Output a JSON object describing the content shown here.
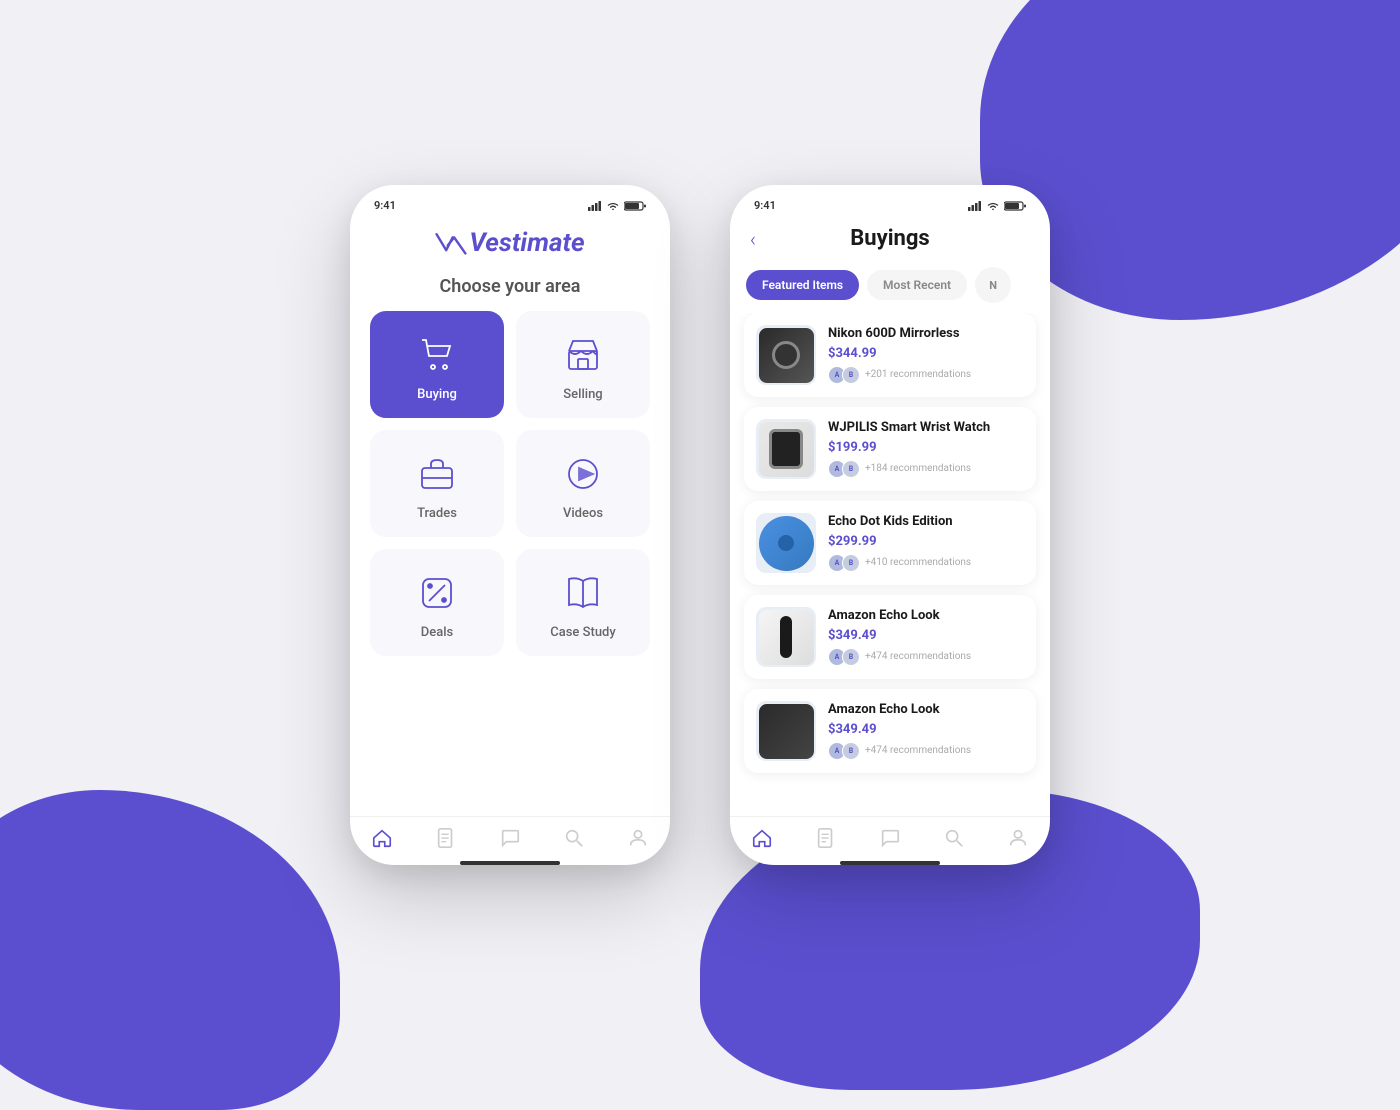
{
  "background": {
    "color": "#f0f0f5",
    "accent": "#5b4fcf"
  },
  "phone1": {
    "status_bar": {
      "time": "9:41",
      "signal": "▲▲▲",
      "wifi": "wifi",
      "battery": "battery"
    },
    "logo": "Vestimate",
    "choose_area_title": "Choose your area",
    "grid_items": [
      {
        "id": "buying",
        "label": "Buying",
        "active": true,
        "icon": "cart"
      },
      {
        "id": "selling",
        "label": "Selling",
        "active": false,
        "icon": "store"
      },
      {
        "id": "trades",
        "label": "Trades",
        "active": false,
        "icon": "briefcase"
      },
      {
        "id": "videos",
        "label": "Videos",
        "active": false,
        "icon": "play"
      },
      {
        "id": "deals",
        "label": "Deals",
        "active": false,
        "icon": "percent"
      },
      {
        "id": "case-study",
        "label": "Case Study",
        "active": false,
        "icon": "book"
      }
    ],
    "bottom_nav": [
      {
        "id": "home",
        "active": true,
        "icon": "home"
      },
      {
        "id": "document",
        "active": false,
        "icon": "document"
      },
      {
        "id": "chat",
        "active": false,
        "icon": "chat"
      },
      {
        "id": "search",
        "active": false,
        "icon": "search"
      },
      {
        "id": "profile",
        "active": false,
        "icon": "profile"
      }
    ]
  },
  "phone2": {
    "status_bar": {
      "time": "9:41",
      "signal": "▲▲▲",
      "wifi": "wifi",
      "battery": "battery"
    },
    "back_label": "‹",
    "title": "Buyings",
    "tabs": [
      {
        "label": "Featured Items",
        "active": true
      },
      {
        "label": "Most Recent",
        "active": false
      },
      {
        "label": "N",
        "active": false,
        "circle": true
      }
    ],
    "items": [
      {
        "name": "Nikon 600D Mirrorless",
        "price": "$344.99",
        "recommendations": "+201 recommendations",
        "img_type": "camera"
      },
      {
        "name": "WJPILIS Smart Wrist Watch",
        "price": "$199.99",
        "recommendations": "+184 recommendations",
        "img_type": "watch"
      },
      {
        "name": "Echo Dot Kids Edition",
        "price": "$299.99",
        "recommendations": "+410 recommendations",
        "img_type": "echo-dot"
      },
      {
        "name": "Amazon Echo Look",
        "price": "$349.49",
        "recommendations": "+474 recommendations",
        "img_type": "echo-look"
      },
      {
        "name": "Amazon Echo Look",
        "price": "$349.49",
        "recommendations": "+474 recommendations",
        "img_type": "echo-look2"
      }
    ],
    "bottom_nav": [
      {
        "id": "home",
        "active": true,
        "icon": "home"
      },
      {
        "id": "document",
        "active": false,
        "icon": "document"
      },
      {
        "id": "chat",
        "active": false,
        "icon": "chat"
      },
      {
        "id": "search",
        "active": false,
        "icon": "search"
      },
      {
        "id": "profile",
        "active": false,
        "icon": "profile"
      }
    ]
  }
}
